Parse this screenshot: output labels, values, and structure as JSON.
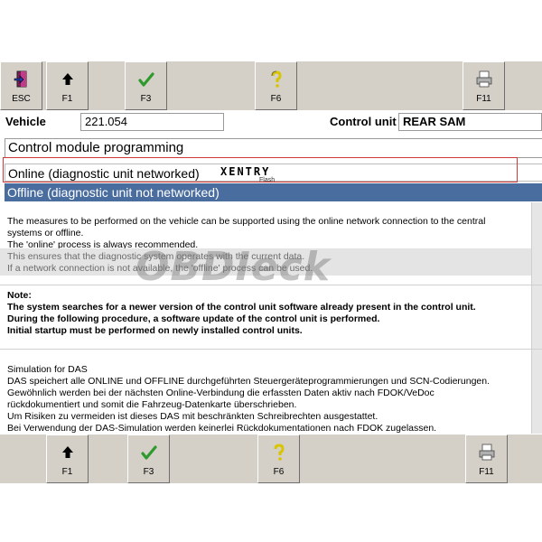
{
  "toolbar_top": [
    {
      "id": "esc",
      "label": "ESC",
      "icon": "exit-door-icon"
    },
    {
      "id": "f1",
      "label": "F1",
      "icon": "arrow-up-icon"
    },
    {
      "id": "f3",
      "label": "F3",
      "icon": "checkmark-icon"
    },
    {
      "id": "f6",
      "label": "F6",
      "icon": "help-question-icon"
    },
    {
      "id": "f11",
      "label": "F11",
      "icon": "printer-icon"
    }
  ],
  "toolbar_bottom": [
    {
      "id": "f1",
      "label": "F1",
      "icon": "arrow-up-icon"
    },
    {
      "id": "f3",
      "label": "F3",
      "icon": "checkmark-icon"
    },
    {
      "id": "f6",
      "label": "F6",
      "icon": "help-question-icon"
    },
    {
      "id": "f11",
      "label": "F11",
      "icon": "printer-icon"
    }
  ],
  "vehicle": {
    "label": "Vehicle",
    "value": "221.054"
  },
  "control_unit": {
    "label": "Control unit",
    "value": "REAR SAM"
  },
  "title": "Control module programming",
  "options": {
    "online": "Online (diagnostic unit networked)",
    "offline": "Offline (diagnostic unit not networked)",
    "xentry_logo": "XENTRY",
    "xentry_sub": "Flash"
  },
  "description": {
    "p1_line1": "The measures to be performed on the vehicle can be supported using the online network connection to the central",
    "p1_line2": "systems or offline.",
    "p1_line3": "The 'online' process is always recommended.",
    "p2_line1": "This ensures that the diagnostic system operates with the current data.",
    "p2_line2": "If a network connection is not available, the 'offline' process can be used.",
    "note_title": "Note:",
    "note_line1": "The system searches for a newer version of the control unit software already present in the control unit.",
    "note_line2": "During the following procedure, a software update of the control unit is performed.",
    "note_line3": "Initial startup must be performed on newly installed control units.",
    "sim_line1": "Simulation for DAS",
    "sim_line2": "DAS speichert alle ONLINE und OFFLINE durchgeführten Steuergeräteprogrammierungen und SCN-Codierungen.",
    "sim_line3": "Gewöhnlich werden bei der nächsten Online-Verbindung die erfassten Daten aktiv nach FDOK/VeDoc",
    "sim_line4": "rückdokumentiert und somit die Fahrzeug-Datenkarte überschrieben.",
    "sim_line5": "Um Risiken zu vermeiden ist dieses DAS mit beschränkten Schreibrechten ausgestattet.",
    "sim_line6": "Bei Verwendung der DAS-Simulation werden keinerlei Rückdokumentationen nach FDOK zugelassen."
  },
  "watermark": "OBDIeck",
  "colors": {
    "selected_row": "#4a6da0",
    "highlight_border": "#d23838",
    "toolbar": "#d4d0c8"
  }
}
